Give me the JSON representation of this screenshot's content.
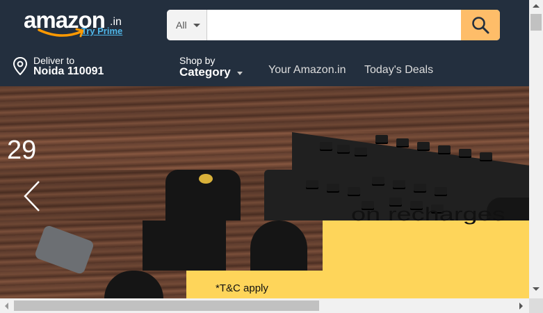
{
  "header": {
    "logo_word": "amazon",
    "logo_tld": ".in",
    "logo_prime": "Try Prime",
    "search": {
      "department": "All",
      "placeholder": "",
      "value": ""
    },
    "deliver": {
      "line1": "Deliver to",
      "line2": "Noida 110091"
    },
    "shop_by": {
      "line1": "Shop by",
      "line2": "Category"
    },
    "nav_links": [
      "Your Amazon.in",
      "Today's Deals"
    ]
  },
  "hero": {
    "number_text": "29",
    "recharge_text": "on recharges",
    "tc_text": "*T&C apply"
  },
  "colors": {
    "header_bg": "#232f3e",
    "search_button": "#febd69",
    "prime_link": "#4fb6e8",
    "banner_yellow": "#fed55a"
  },
  "icons": [
    "search-icon",
    "location-pin-icon",
    "chevron-left-icon",
    "caret-down-icon"
  ]
}
